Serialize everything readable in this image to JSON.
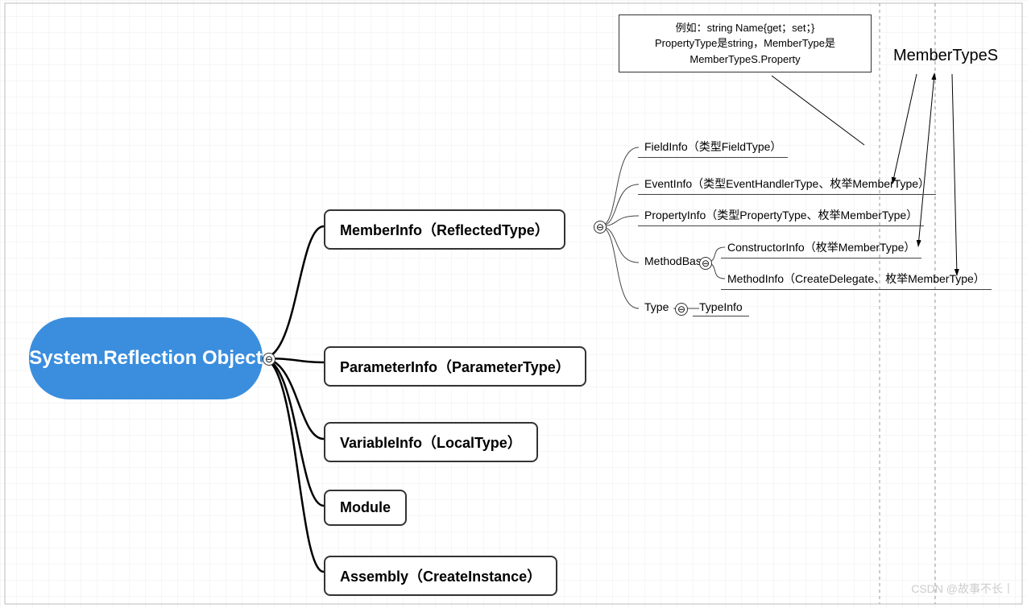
{
  "root": {
    "title": "System.Reflection Object"
  },
  "children": [
    {
      "label": "MemberInfo（ReflectedType）"
    },
    {
      "label": "ParameterInfo（ParameterType）"
    },
    {
      "label": "VariableInfo（LocalType）"
    },
    {
      "label": "Module"
    },
    {
      "label": "Assembly（CreateInstance）"
    }
  ],
  "memberinfo_children": [
    {
      "label": "FieldInfo（类型FieldType）"
    },
    {
      "label": "EventInfo（类型EventHandlerType、枚举MemberType）"
    },
    {
      "label": "PropertyInfo（类型PropertyType、枚举MemberType）"
    },
    {
      "label": "MethodBase"
    },
    {
      "label": "Type"
    }
  ],
  "methodbase_children": [
    {
      "label": "ConstructorInfo（枚举MemberType）"
    },
    {
      "label": "MethodInfo（CreateDelegate、枚举MemberType）"
    }
  ],
  "type_child": {
    "label": "TypeInfo"
  },
  "annotation": {
    "line1": "例如：string Name{get；set；}",
    "line2": "PropertyType是string，MemberType是",
    "line3": "MemberTypeS.Property"
  },
  "heading": "MemberTypeS",
  "toggle": {
    "minus": "⊖"
  },
  "watermark": "CSDN @故事不长丨"
}
